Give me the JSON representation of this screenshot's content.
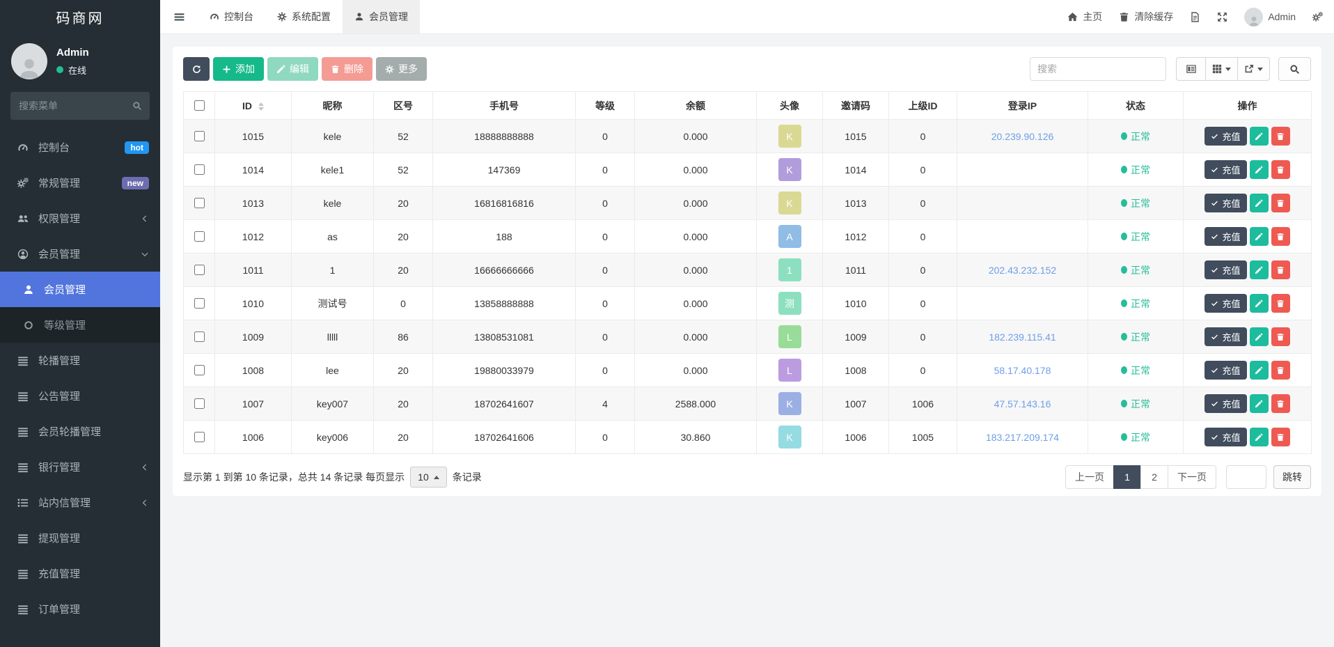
{
  "brand": "码商网",
  "theme_colors": {
    "sidebar_bg": "#242e34",
    "active_menu_item": "#5175dd",
    "primary_navy": "#414d5d",
    "accent_green": "#16b98a",
    "danger_red": "#ee5a52",
    "link_blue": "#6d9ee8",
    "status_green": "#26bd9a",
    "badge_hot": "#2196f3",
    "badge_new": "#6e6cb1"
  },
  "sidebar": {
    "user": {
      "name": "Admin",
      "status": "在线"
    },
    "search_placeholder": "搜索菜单",
    "items": [
      {
        "label": "控制台",
        "icon": "gauge-icon",
        "badge": "hot"
      },
      {
        "label": "常规管理",
        "icon": "gears-icon",
        "badge": "new"
      },
      {
        "label": "权限管理",
        "icon": "users-icon",
        "collapsed": true
      },
      {
        "label": "会员管理",
        "icon": "user-circle-icon",
        "expanded": true
      },
      {
        "label": "会员管理",
        "icon": "user-icon",
        "active": true
      },
      {
        "label": "等级管理",
        "icon": "circle-icon"
      },
      {
        "label": "轮播管理",
        "icon": "list-icon"
      },
      {
        "label": "公告管理",
        "icon": "list-icon"
      },
      {
        "label": "会员轮播管理",
        "icon": "list-icon"
      },
      {
        "label": "银行管理",
        "icon": "list-icon",
        "collapsed": true
      },
      {
        "label": "站内信管理",
        "icon": "list-ul-icon",
        "collapsed": true
      },
      {
        "label": "提现管理",
        "icon": "list-icon"
      },
      {
        "label": "充值管理",
        "icon": "list-icon"
      },
      {
        "label": "订单管理",
        "icon": "list-icon"
      }
    ]
  },
  "topbar": {
    "tabs": [
      {
        "label": "控制台"
      },
      {
        "label": "系统配置"
      },
      {
        "label": "会员管理",
        "active": true
      }
    ],
    "home_label": "主页",
    "clear_cache_label": "清除缓存",
    "user_name": "Admin"
  },
  "toolbar": {
    "add_label": "添加",
    "edit_label": "编辑",
    "delete_label": "删除",
    "more_label": "更多",
    "search_placeholder": "搜索"
  },
  "table": {
    "headers": [
      "ID",
      "昵称",
      "区号",
      "手机号",
      "等级",
      "余额",
      "头像",
      "邀请码",
      "上级ID",
      "登录IP",
      "状态",
      "操作"
    ],
    "recharge_label": "充值",
    "rows": [
      {
        "id": "1015",
        "nickname": "kele",
        "area_code": "52",
        "phone": "18888888888",
        "level": "0",
        "balance": "0.000",
        "avatar_letter": "K",
        "avatar_color": "#d9d993",
        "invite_code": "1015",
        "parent_id": "0",
        "login_ip": "20.239.90.126",
        "status": "正常"
      },
      {
        "id": "1014",
        "nickname": "kele1",
        "area_code": "52",
        "phone": "147369",
        "level": "0",
        "balance": "0.000",
        "avatar_letter": "K",
        "avatar_color": "#b19ddb",
        "invite_code": "1014",
        "parent_id": "0",
        "login_ip": "",
        "status": "正常"
      },
      {
        "id": "1013",
        "nickname": "kele",
        "area_code": "20",
        "phone": "16816816816",
        "level": "0",
        "balance": "0.000",
        "avatar_letter": "K",
        "avatar_color": "#d9d993",
        "invite_code": "1013",
        "parent_id": "0",
        "login_ip": "",
        "status": "正常"
      },
      {
        "id": "1012",
        "nickname": "as",
        "area_code": "20",
        "phone": "188",
        "level": "0",
        "balance": "0.000",
        "avatar_letter": "A",
        "avatar_color": "#90bce6",
        "invite_code": "1012",
        "parent_id": "0",
        "login_ip": "",
        "status": "正常"
      },
      {
        "id": "1011",
        "nickname": "1",
        "area_code": "20",
        "phone": "16666666666",
        "level": "0",
        "balance": "0.000",
        "avatar_letter": "1",
        "avatar_color": "#8ce0c0",
        "invite_code": "1011",
        "parent_id": "0",
        "login_ip": "202.43.232.152",
        "status": "正常"
      },
      {
        "id": "1010",
        "nickname": "测试号",
        "area_code": "0",
        "phone": "13858888888",
        "level": "0",
        "balance": "0.000",
        "avatar_letter": "测",
        "avatar_color": "#8ce0c0",
        "invite_code": "1010",
        "parent_id": "0",
        "login_ip": "",
        "status": "正常"
      },
      {
        "id": "1009",
        "nickname": "lllll",
        "area_code": "86",
        "phone": "13808531081",
        "level": "0",
        "balance": "0.000",
        "avatar_letter": "L",
        "avatar_color": "#99dc99",
        "invite_code": "1009",
        "parent_id": "0",
        "login_ip": "182.239.115.41",
        "status": "正常"
      },
      {
        "id": "1008",
        "nickname": "lee",
        "area_code": "20",
        "phone": "19880033979",
        "level": "0",
        "balance": "0.000",
        "avatar_letter": "L",
        "avatar_color": "#bb9ce0",
        "invite_code": "1008",
        "parent_id": "0",
        "login_ip": "58.17.40.178",
        "status": "正常"
      },
      {
        "id": "1007",
        "nickname": "key007",
        "area_code": "20",
        "phone": "18702641607",
        "level": "4",
        "balance": "2588.000",
        "avatar_letter": "K",
        "avatar_color": "#9cafe4",
        "invite_code": "1007",
        "parent_id": "1006",
        "login_ip": "47.57.143.16",
        "status": "正常"
      },
      {
        "id": "1006",
        "nickname": "key006",
        "area_code": "20",
        "phone": "18702641606",
        "level": "0",
        "balance": "30.860",
        "avatar_letter": "K",
        "avatar_color": "#95dbe2",
        "invite_code": "1006",
        "parent_id": "1005",
        "login_ip": "183.217.209.174",
        "status": "正常"
      }
    ]
  },
  "footer": {
    "summary_prefix": "显示第 1 到第 10 条记录，总共 14 条记录 每页显示",
    "page_size": "10",
    "summary_suffix": "条记录",
    "pagination": {
      "prev": "上一页",
      "pages": [
        "1",
        "2"
      ],
      "active_page": "1",
      "next": "下一页",
      "jump_label": "跳转"
    }
  }
}
